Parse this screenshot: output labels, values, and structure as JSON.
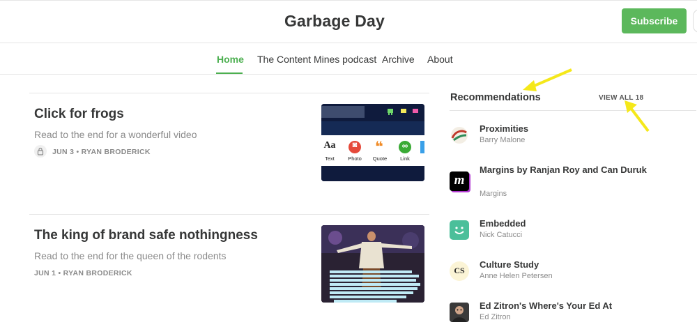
{
  "header": {
    "title": "Garbage Day",
    "subscribe_label": "Subscribe"
  },
  "nav": {
    "items": [
      {
        "label": "Home",
        "active": true
      },
      {
        "label": "The Content Mines podcast",
        "active": false
      },
      {
        "label": "Archive",
        "active": false
      },
      {
        "label": "About",
        "active": false
      }
    ],
    "accent_color": "#4caf50"
  },
  "posts": [
    {
      "title": "Click for frogs",
      "subtitle": "Read to the end for a wonderful video",
      "meta": "JUN 3 • RYAN BRODERICK",
      "locked": true,
      "thumbnail": {
        "icons": [
          {
            "glyph": "Aa",
            "label": "Text",
            "icon": "text-icon"
          },
          {
            "glyph": "◙",
            "label": "Photo",
            "icon": "camera-icon"
          },
          {
            "glyph": "❝",
            "label": "Quote",
            "icon": "quote-icon"
          },
          {
            "glyph": "∞",
            "label": "Link",
            "icon": "link-icon"
          }
        ]
      }
    },
    {
      "title": "The king of brand safe nothingness",
      "subtitle": "Read to the end for the queen of the rodents",
      "meta": "JUN 1 • RYAN BRODERICK",
      "locked": false
    }
  ],
  "recommendations": {
    "heading": "Recommendations",
    "view_all": "VIEW ALL 18",
    "items": [
      {
        "name": "Proximities",
        "author": "Barry Malone",
        "logo": "proximities-logo"
      },
      {
        "name": "Margins by Ranjan Roy and Can Duruk",
        "author": "Margins",
        "logo": "margins-logo",
        "logo_text": "m"
      },
      {
        "name": "Embedded",
        "author": "Nick Catucci",
        "logo": "smiley-logo"
      },
      {
        "name": "Culture Study",
        "author": "Anne Helen Petersen",
        "logo": "culture-study-logo",
        "logo_text": "CS"
      },
      {
        "name": "Ed Zitron's Where's Your Ed At",
        "author": "Ed Zitron",
        "logo": "ed-zitron-avatar"
      }
    ]
  },
  "colors": {
    "subscribe": "#5cb85c",
    "annotation_arrow": "#f5e81a",
    "text": "#363737",
    "muted": "#8a8a8a"
  }
}
